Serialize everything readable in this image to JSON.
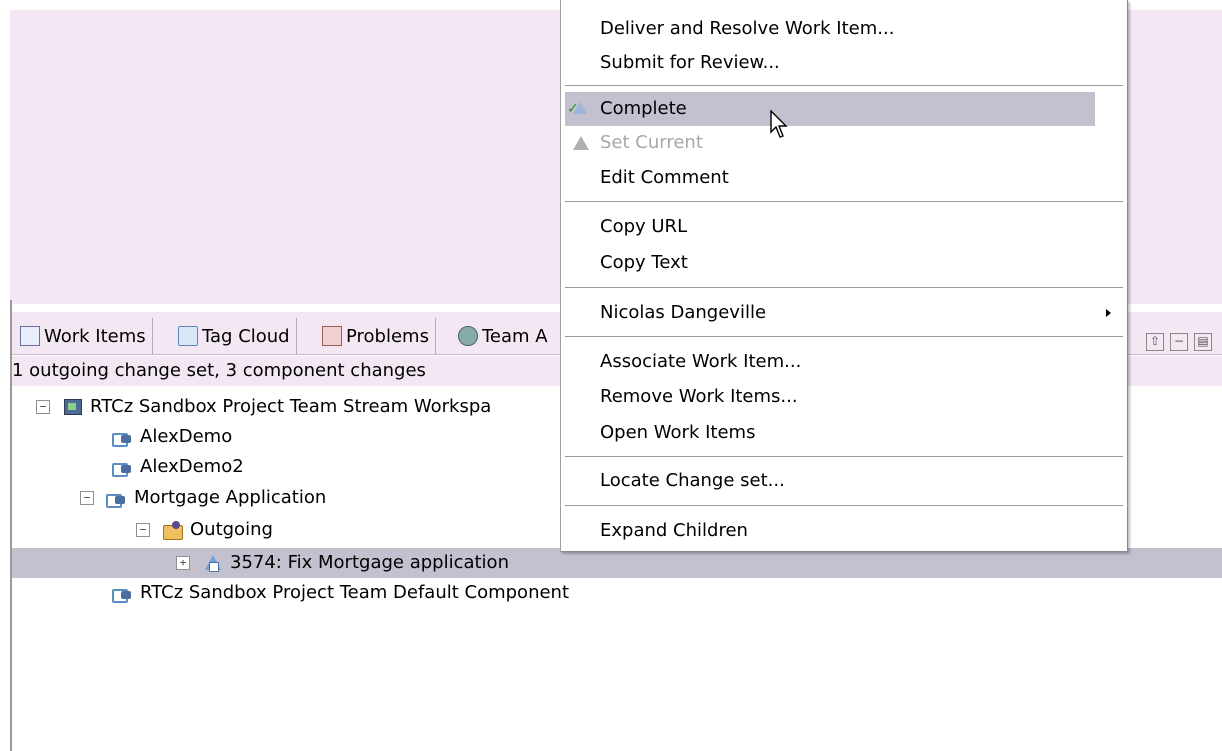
{
  "context_menu": {
    "items": [
      {
        "label": "Deliver and Resolve Work Item...",
        "enabled": true
      },
      {
        "label": "Submit for Review...",
        "enabled": true
      },
      {
        "label": "Complete",
        "enabled": true,
        "icon": "complete-icon",
        "highlighted": true
      },
      {
        "label": "Set Current",
        "enabled": false,
        "icon": "set-current-icon"
      },
      {
        "label": "Edit Comment",
        "enabled": true
      },
      {
        "label": "Copy URL",
        "enabled": true
      },
      {
        "label": "Copy Text",
        "enabled": true
      },
      {
        "label": "Nicolas Dangeville",
        "enabled": true,
        "submenu": true
      },
      {
        "label": "Associate Work Item...",
        "enabled": true
      },
      {
        "label": "Remove Work Items...",
        "enabled": true
      },
      {
        "label": "Open Work Items",
        "enabled": true
      },
      {
        "label": "Locate Change set...",
        "enabled": true
      },
      {
        "label": "Expand Children",
        "enabled": true
      }
    ]
  },
  "tabs": [
    {
      "label": "Work Items",
      "icon": "work-items-icon"
    },
    {
      "label": "Tag Cloud",
      "icon": "tag-cloud-icon"
    },
    {
      "label": "Problems",
      "icon": "problems-icon"
    },
    {
      "label": "Team A",
      "icon": "team-icon"
    }
  ],
  "summary": "1 outgoing change set, 3 component changes",
  "tree": {
    "workspace": "RTCz Sandbox Project Team Stream Workspa",
    "items": [
      {
        "label": "AlexDemo",
        "icon": "component-icon"
      },
      {
        "label": "AlexDemo2",
        "icon": "component-icon"
      },
      {
        "label": "Mortgage Application",
        "icon": "component-icon"
      },
      {
        "label": "Outgoing",
        "icon": "outgoing-folder-icon"
      },
      {
        "label": "3574: Fix Mortgage application",
        "icon": "change-set-icon"
      },
      {
        "label": "RTCz Sandbox Project Team Default Component",
        "icon": "component-icon"
      }
    ]
  },
  "colors": {
    "pane_background": "#f4e7f4",
    "selection": "#c3c0d0",
    "disabled_text": "#a8a8a8"
  }
}
